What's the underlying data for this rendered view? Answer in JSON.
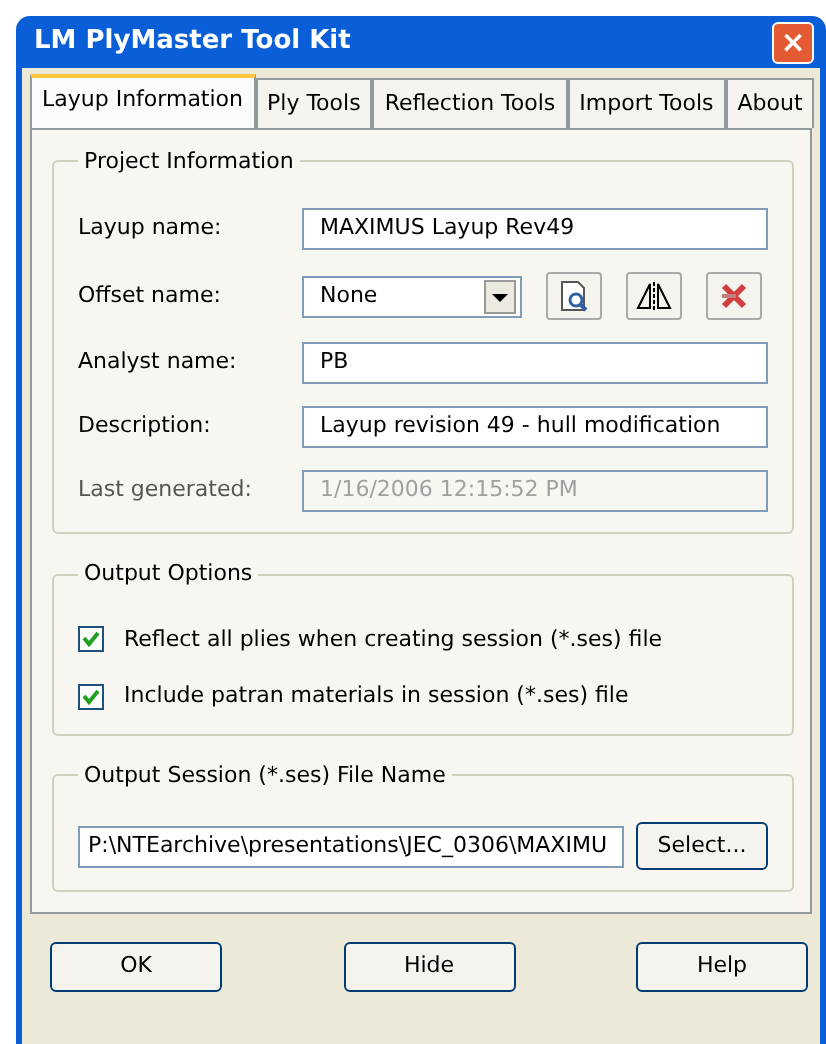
{
  "window": {
    "title": "LM PlyMaster Tool Kit",
    "close": "×"
  },
  "tabs": [
    {
      "label": "Layup Information",
      "selected": true
    },
    {
      "label": "Ply Tools",
      "selected": false
    },
    {
      "label": "Reflection Tools",
      "selected": false
    },
    {
      "label": "Import Tools",
      "selected": false
    },
    {
      "label": "About",
      "selected": false
    }
  ],
  "project_information": {
    "title": "Project Information",
    "fields": [
      {
        "kind": "text",
        "label": "Layup name:",
        "value": "MAXIMUS Layup Rev49",
        "disabled": false
      },
      {
        "kind": "dropdown",
        "label": "Offset name:",
        "value": "None"
      },
      {
        "kind": "text",
        "label": "Analyst name:",
        "value": "PB",
        "disabled": false
      },
      {
        "kind": "text",
        "label": "Description:",
        "value": "Layup revision 49 - hull modification",
        "disabled": false
      },
      {
        "kind": "text",
        "label": "Last generated:",
        "value": "1/16/2006 12:15:52 PM",
        "disabled": true
      }
    ]
  },
  "output_options": {
    "title": "Output Options",
    "checkboxes": [
      {
        "label": "Reflect all plies when creating session (*.ses)  file",
        "checked": true
      },
      {
        "label": "Include patran materials in session (*.ses) file",
        "checked": true
      }
    ]
  },
  "output_session": {
    "title": "Output Session (*.ses) File Name",
    "value": "P:\\NTEarchive\\presentations\\JEC_0306\\MAXIMU",
    "button": "Select..."
  },
  "buttons": [
    "OK",
    "Hide",
    "Help"
  ]
}
